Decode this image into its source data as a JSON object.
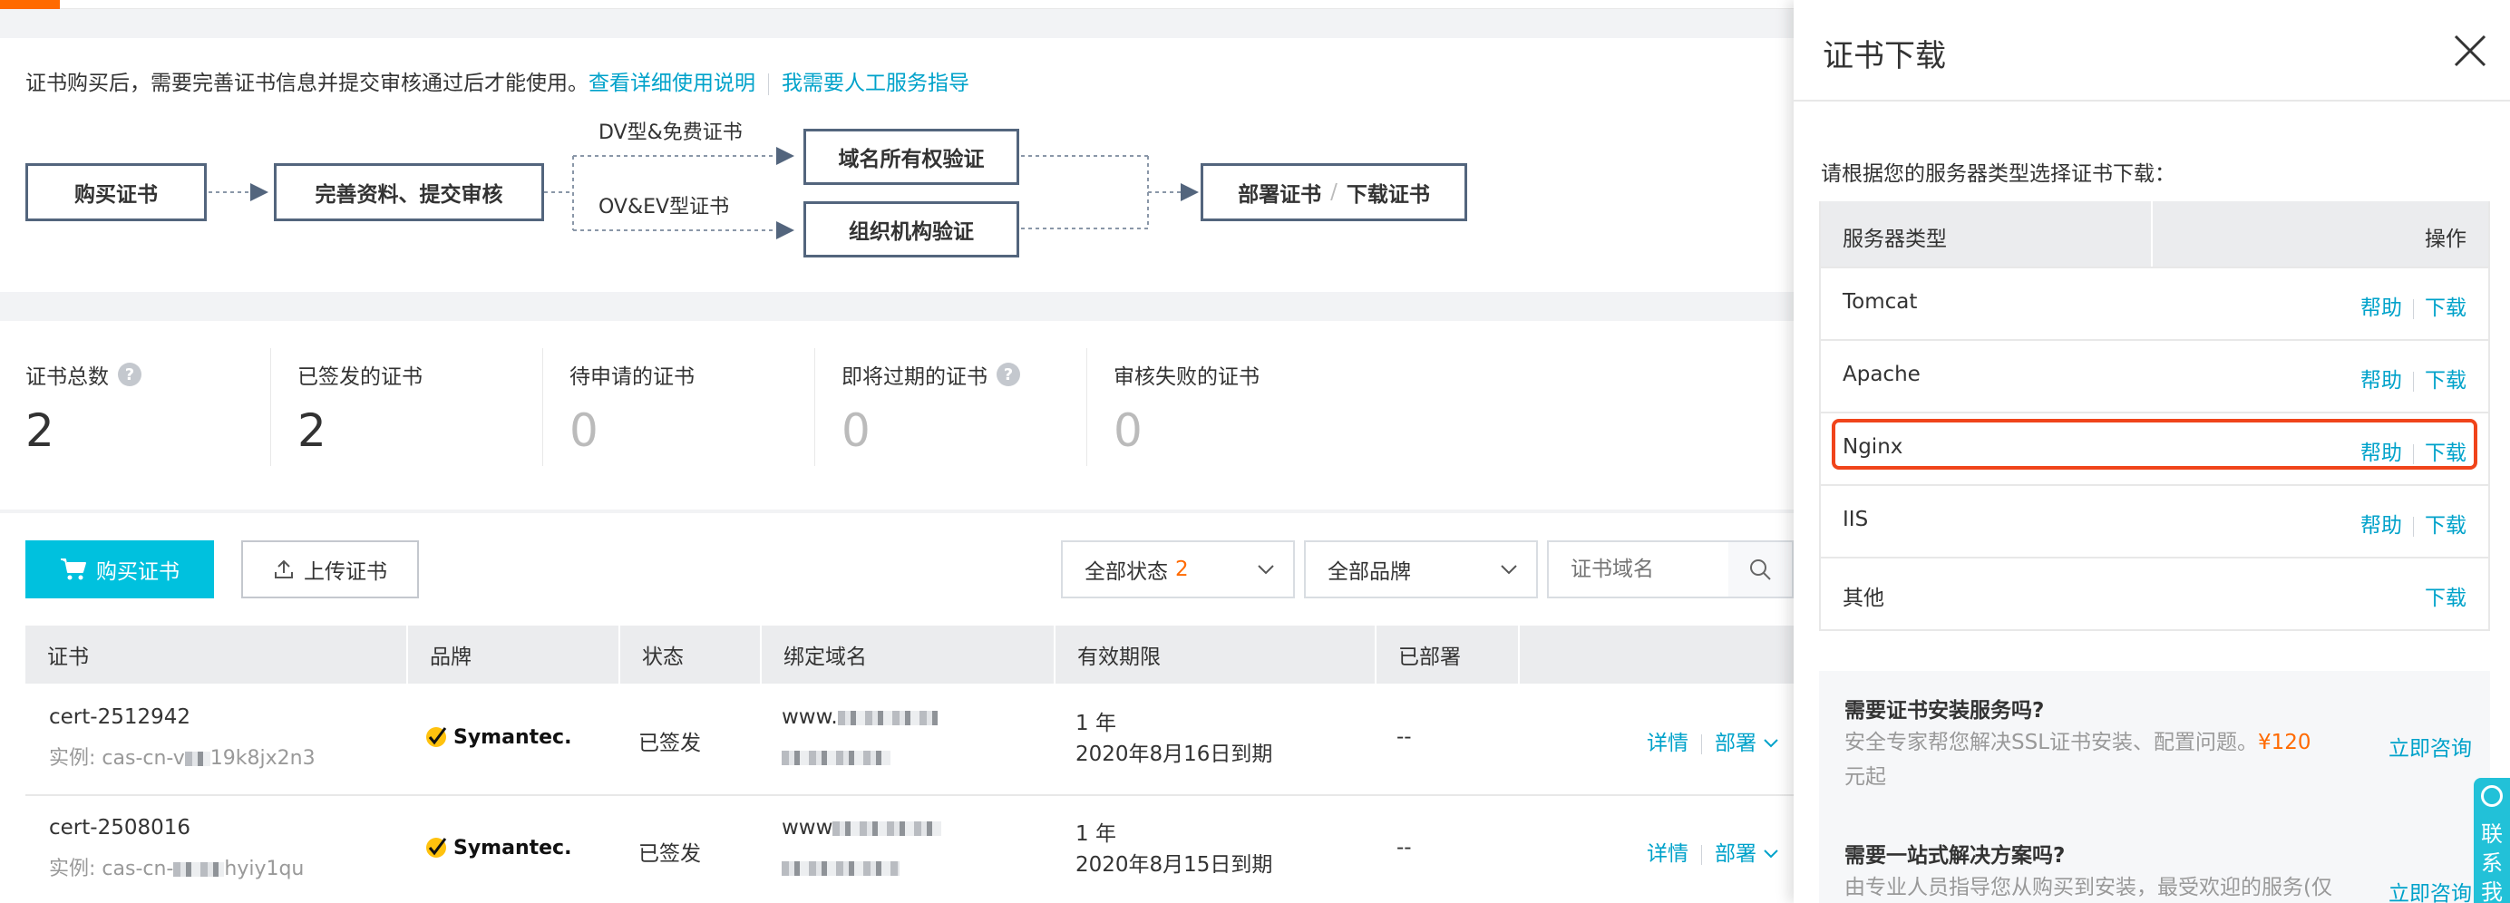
{
  "intro": {
    "text": "证书购买后，需要完善证书信息并提交审核通过后才能使用。",
    "link_guide": "查看详细使用说明",
    "link_manual": "我需要人工服务指导"
  },
  "flow": {
    "buy": "购买证书",
    "complete": "完善资料、提交审核",
    "dv_label": "DV型&免费证书",
    "ov_label": "OV&EV型证书",
    "domain_verify": "域名所有权验证",
    "org_verify": "组织机构验证",
    "deploy": "部署证书",
    "download": "下载证书",
    "slash": "/"
  },
  "stats": {
    "total_label": "证书总数",
    "total_value": "2",
    "issued_label": "已签发的证书",
    "issued_value": "2",
    "pending_label": "待申请的证书",
    "pending_value": "0",
    "expiring_label": "即将过期的证书",
    "expiring_value": "0",
    "failed_label": "审核失败的证书",
    "failed_value": "0",
    "help_glyph": "?"
  },
  "toolbar": {
    "buy_label": "购买证书",
    "upload_label": "上传证书",
    "status_filter": "全部状态",
    "status_count": "2",
    "brand_filter": "全部品牌",
    "search_placeholder": "证书域名"
  },
  "table": {
    "headers": [
      "证书",
      "品牌",
      "状态",
      "绑定域名",
      "有效期限",
      "已部署"
    ],
    "rows": [
      {
        "name": "cert-2512942",
        "instance_prefix": "实例: cas-cn-v",
        "instance_suffix": "19k8jx2n3",
        "brand": "Symantec.",
        "status": "已签发",
        "domain_prefix": "www.",
        "validity_years": "1 年",
        "validity_date": "2020年8月16日到期",
        "deployed": "--",
        "action_detail": "详情",
        "action_deploy": "部署"
      },
      {
        "name": "cert-2508016",
        "instance_prefix": "实例: cas-cn-",
        "instance_suffix": "hyiy1qu",
        "brand": "Symantec.",
        "status": "已签发",
        "domain_prefix": "www",
        "validity_years": "1 年",
        "validity_date": "2020年8月15日到期",
        "deployed": "--",
        "action_detail": "详情",
        "action_deploy": "部署"
      }
    ]
  },
  "drawer": {
    "title": "证书下载",
    "hint": "请根据您的服务器类型选择证书下载：",
    "col_server": "服务器类型",
    "col_action": "操作",
    "help_label": "帮助",
    "download_label": "下载",
    "servers": [
      {
        "name": "Tomcat"
      },
      {
        "name": "Apache"
      },
      {
        "name": "Nginx"
      },
      {
        "name": "IIS"
      },
      {
        "name": "其他"
      }
    ],
    "promo1_title": "需要证书安装服务吗?",
    "promo1_desc": "安全专家帮您解决SSL证书安装、配置问题。",
    "promo1_price": "¥120",
    "promo1_desc2": "元起",
    "promo1_link": "立即咨询",
    "promo2_title": "需要一站式解决方案吗?",
    "promo2_desc": "由专业人员指导您从购买到安装，最受欢迎的服务(仅",
    "promo2_link": "立即咨询"
  },
  "contact": {
    "label": "联系我"
  },
  "colors": {
    "accent_cyan": "#00c1de",
    "link_blue": "#00a2ca",
    "orange": "#ff6a00",
    "highlight_red": "#f0441b",
    "flow_border": "#53657d"
  }
}
